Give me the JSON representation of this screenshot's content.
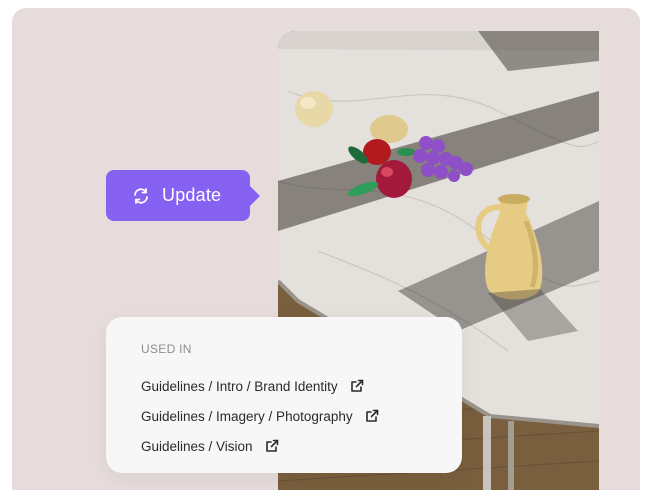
{
  "update_button": {
    "label": "Update",
    "icon": "refresh-icon",
    "color": "#8661f2"
  },
  "used_in": {
    "heading": "USED IN",
    "items": [
      {
        "label": "Guidelines / Intro / Brand Identity",
        "icon": "external-link-icon"
      },
      {
        "label": "Guidelines / Imagery / Photography",
        "icon": "external-link-icon"
      },
      {
        "label": "Guidelines / Vision",
        "icon": "external-link-icon"
      }
    ]
  },
  "colors": {
    "background": "#e6dcdc",
    "panel": "#f8f7f7",
    "accent": "#8661f2"
  }
}
